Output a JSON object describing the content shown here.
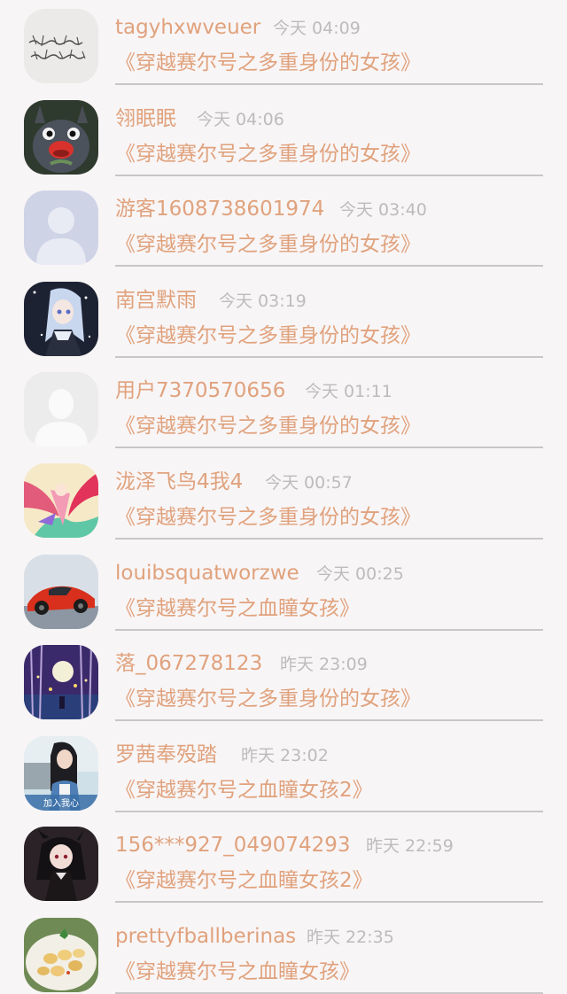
{
  "entries": [
    {
      "name": "tagyhxwveuer",
      "time": "今天 04:09",
      "book": "《穿越赛尔号之多重身份的女孩》",
      "avatar": "handwriting-note-avatar"
    },
    {
      "name": "翎眠眠",
      "time": "今天 04:06",
      "book": "《穿越赛尔号之多重身份的女孩》",
      "avatar": "totoro-avatar"
    },
    {
      "name": "游客1608738601974",
      "time": "今天 03:40",
      "book": "《穿越赛尔号之多重身份的女孩》",
      "avatar": "default-guest-avatar"
    },
    {
      "name": "南宫默雨",
      "time": "今天 03:19",
      "book": "《穿越赛尔号之多重身份的女孩》",
      "avatar": "anime-girl-avatar"
    },
    {
      "name": "用户7370570656",
      "time": "今天 01:11",
      "book": "《穿越赛尔号之多重身份的女孩》",
      "avatar": "default-user-avatar"
    },
    {
      "name": "泷泽飞鸟4我4",
      "time": "今天 00:57",
      "book": "《穿越赛尔号之多重身份的女孩》",
      "avatar": "colorful-anime-avatar"
    },
    {
      "name": "louibsquatworzwe",
      "time": "今天 00:25",
      "book": "《穿越赛尔号之血瞳女孩》",
      "avatar": "red-sports-car-avatar"
    },
    {
      "name": "落_067278123",
      "time": "昨天 23:09",
      "book": "《穿越赛尔号之多重身份的女孩》",
      "avatar": "night-forest-moon-avatar"
    },
    {
      "name": "罗茜奉殁踏",
      "time": "昨天 23:02",
      "book": "《穿越赛尔号之血瞳女孩2》",
      "avatar": "girl-photo-avatar"
    },
    {
      "name": "156***927_049074293",
      "time": "昨天 22:59",
      "book": "《穿越赛尔号之血瞳女孩2》",
      "avatar": "dark-anime-girl-avatar"
    },
    {
      "name": "prettyfballberinas",
      "time": "昨天 22:35",
      "book": "《穿越赛尔号之血瞳女孩》",
      "avatar": "food-dish-avatar"
    }
  ],
  "avatar_caption_9": "加入我心",
  "colors": {
    "accent": "#e0a27d",
    "time": "#bcbcbc",
    "divider": "#c9c6c7",
    "background": "#f8f5f6"
  }
}
